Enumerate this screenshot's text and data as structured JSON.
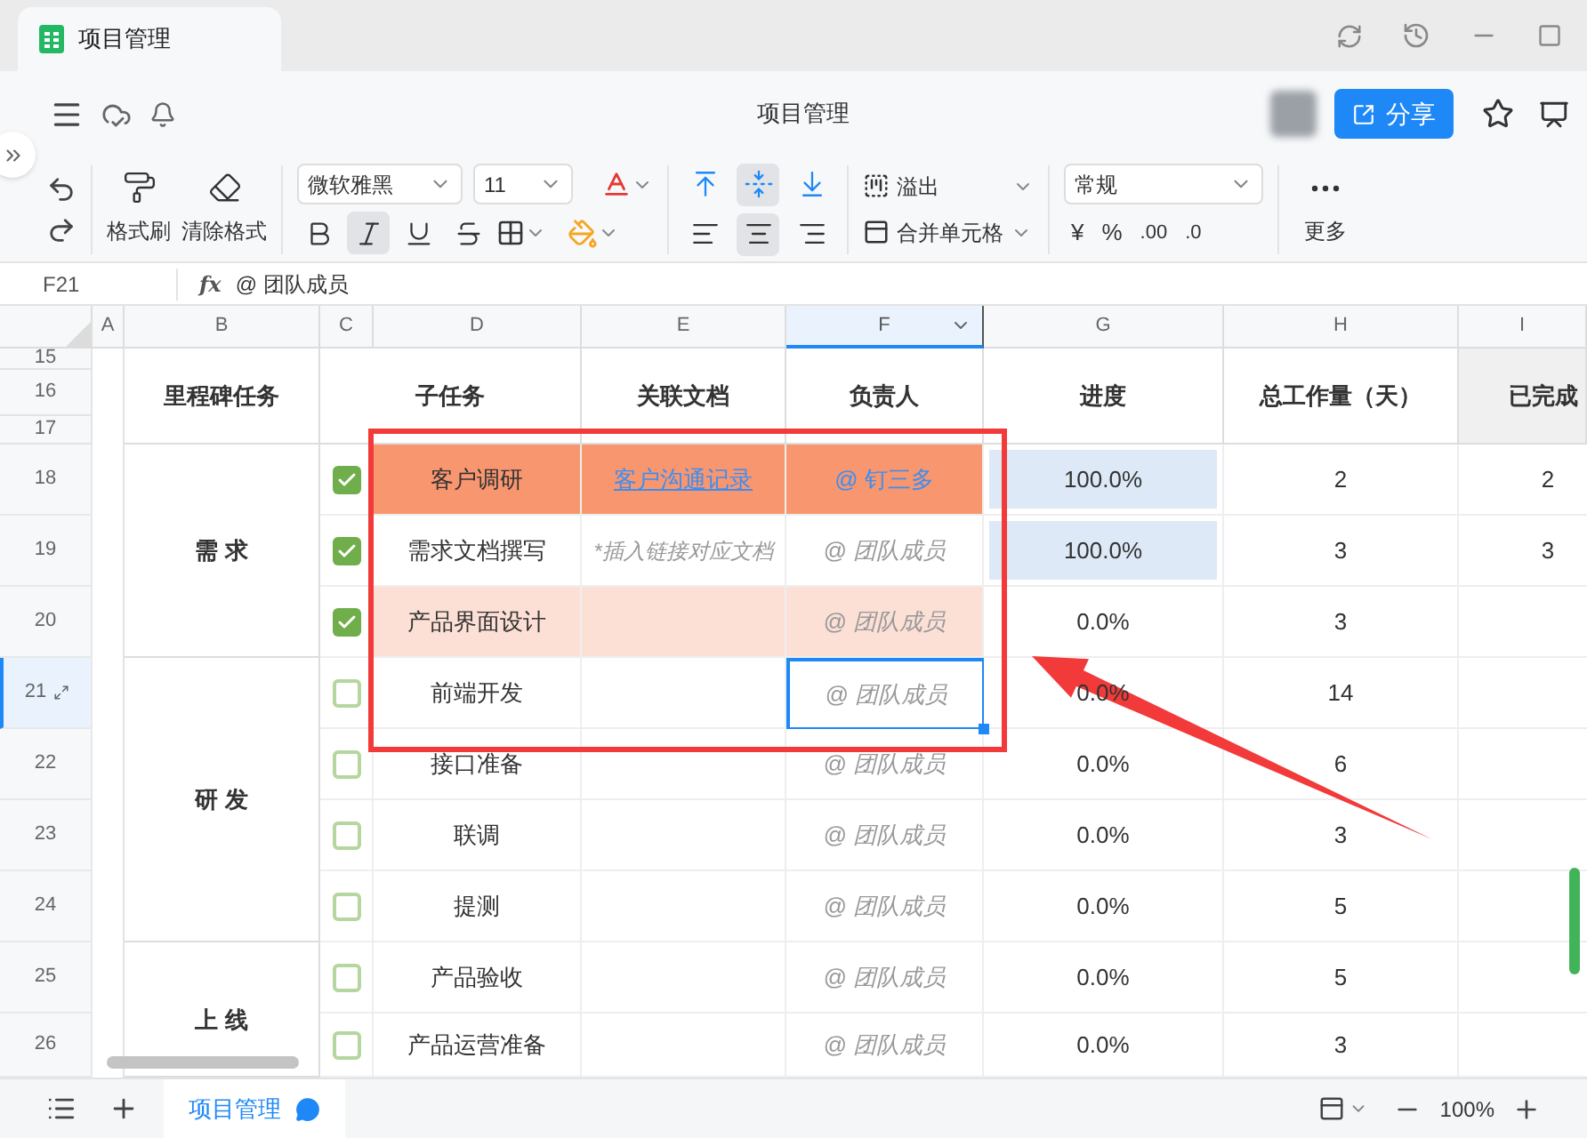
{
  "window": {
    "tab_title": "项目管理"
  },
  "header": {
    "title": "项目管理",
    "share_label": "分享"
  },
  "toolbar": {
    "format_painter": "格式刷",
    "clear_format": "清除格式",
    "font": "微软雅黑",
    "size": "11",
    "overflow": "溢出",
    "merge": "合并单元格",
    "number_format": "常规",
    "more": "更多",
    "number_buttons": [
      "¥",
      "%",
      ".00",
      ".0"
    ],
    "styles": [
      {
        "kind": "bold",
        "selected": false
      },
      {
        "kind": "italic",
        "selected": true
      },
      {
        "kind": "underline",
        "selected": false
      },
      {
        "kind": "strike",
        "selected": false
      }
    ],
    "valign": [
      {
        "kind": "top",
        "selected": false
      },
      {
        "kind": "middle",
        "selected": true
      },
      {
        "kind": "bottom",
        "selected": false
      }
    ],
    "halign": [
      {
        "kind": "left",
        "selected": false
      },
      {
        "kind": "center",
        "selected": true
      },
      {
        "kind": "right",
        "selected": false
      }
    ]
  },
  "formula_bar": {
    "cell": "F21",
    "fx": "fx",
    "value": "@ 团队成员"
  },
  "columns": [
    {
      "label": "A",
      "selected": false
    },
    {
      "label": "B",
      "selected": false
    },
    {
      "label": "C",
      "selected": false
    },
    {
      "label": "D",
      "selected": false
    },
    {
      "label": "E",
      "selected": false
    },
    {
      "label": "F",
      "selected": true
    },
    {
      "label": "G",
      "selected": false
    },
    {
      "label": "H",
      "selected": false
    },
    {
      "label": "I",
      "selected": false
    }
  ],
  "header_rows": [
    "15",
    "16",
    "17"
  ],
  "headings": [
    "里程碑任务",
    "子任务",
    "关联文档",
    "负责人",
    "进度",
    "总工作量（天）",
    "已完成"
  ],
  "groups": [
    {
      "label": "需 求",
      "rows": [
        {
          "number": "18",
          "selected": false,
          "checked": true,
          "task": "客户调研",
          "doc": "客户沟通记录",
          "doc_link": true,
          "owner": "@ 钉三多",
          "owner_mention": true,
          "progress": "100.0%",
          "progress_filled": true,
          "total": "2",
          "done": "2",
          "color": "#f8966f"
        },
        {
          "number": "19",
          "selected": false,
          "checked": true,
          "task": "需求文档撰写",
          "doc": "*插入链接对应文档",
          "doc_link": false,
          "owner": "@ 团队成员",
          "owner_mention": false,
          "progress": "100.0%",
          "progress_filled": true,
          "total": "3",
          "done": "3"
        },
        {
          "number": "20",
          "selected": false,
          "checked": true,
          "task": "产品界面设计",
          "owner": "@ 团队成员",
          "owner_mention": false,
          "progress": "0.0%",
          "progress_filled": false,
          "total": "3",
          "color": "#fce0d6"
        }
      ]
    },
    {
      "label": "研 发",
      "rows": [
        {
          "number": "21",
          "selected": true,
          "checked": false,
          "task": "前端开发",
          "owner": "@ 团队成员",
          "owner_mention": false,
          "progress": "0.0%",
          "progress_filled": false,
          "total": "14"
        },
        {
          "number": "22",
          "selected": false,
          "checked": false,
          "task": "接口准备",
          "owner": "@ 团队成员",
          "owner_mention": false,
          "progress": "0.0%",
          "progress_filled": false,
          "total": "6"
        },
        {
          "number": "23",
          "selected": false,
          "checked": false,
          "task": "联调",
          "owner": "@ 团队成员",
          "owner_mention": false,
          "progress": "0.0%",
          "progress_filled": false,
          "total": "3"
        },
        {
          "number": "24",
          "selected": false,
          "checked": false,
          "task": "提测",
          "owner": "@ 团队成员",
          "owner_mention": false,
          "progress": "0.0%",
          "progress_filled": false,
          "total": "5"
        }
      ]
    },
    {
      "label": "上 线",
      "rows": [
        {
          "number": "25",
          "selected": false,
          "checked": false,
          "task": "产品验收",
          "owner": "@ 团队成员",
          "owner_mention": false,
          "progress": "0.0%",
          "progress_filled": false,
          "total": "5"
        },
        {
          "number": "26",
          "selected": false,
          "checked": false,
          "task": "产品运营准备",
          "owner": "@ 团队成员",
          "owner_mention": false,
          "progress": "0.0%",
          "progress_filled": false,
          "total": "3"
        }
      ]
    }
  ],
  "sheet_tabs": [
    {
      "label": "项目管理",
      "selected": true
    }
  ],
  "zoom": "100%"
}
